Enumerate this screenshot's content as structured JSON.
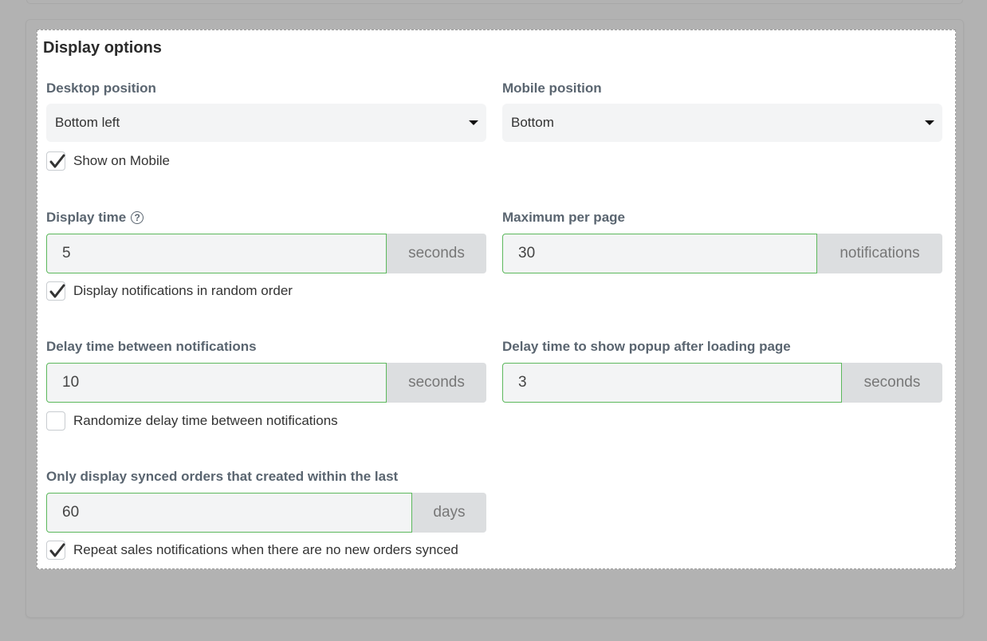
{
  "panel": {
    "title": "Display options"
  },
  "desktop_position": {
    "label": "Desktop position",
    "value": "Bottom left"
  },
  "mobile_position": {
    "label": "Mobile position",
    "value": "Bottom"
  },
  "show_on_mobile": {
    "label": "Show on Mobile",
    "checked": true
  },
  "display_time": {
    "label": "Display time",
    "help_icon": "?",
    "value": "5",
    "unit": "seconds"
  },
  "maximum_per_page": {
    "label": "Maximum per page",
    "value": "30",
    "unit": "notifications"
  },
  "random_order": {
    "label": "Display notifications in random order",
    "checked": true
  },
  "delay_between": {
    "label": "Delay time between notifications",
    "value": "10",
    "unit": "seconds"
  },
  "delay_popup": {
    "label": "Delay time to show popup after loading page",
    "value": "3",
    "unit": "seconds"
  },
  "randomize_delay": {
    "label": "Randomize delay time between notifications",
    "checked": false
  },
  "synced_orders": {
    "label": "Only display synced orders that created within the last",
    "value": "60",
    "unit": "days"
  },
  "repeat_sales": {
    "label": "Repeat sales notifications when there are no new orders synced",
    "checked": true
  },
  "colors": {
    "page_background": "#b2b2b2",
    "input_border": "#5cb85c",
    "label_color": "#5a6570"
  }
}
